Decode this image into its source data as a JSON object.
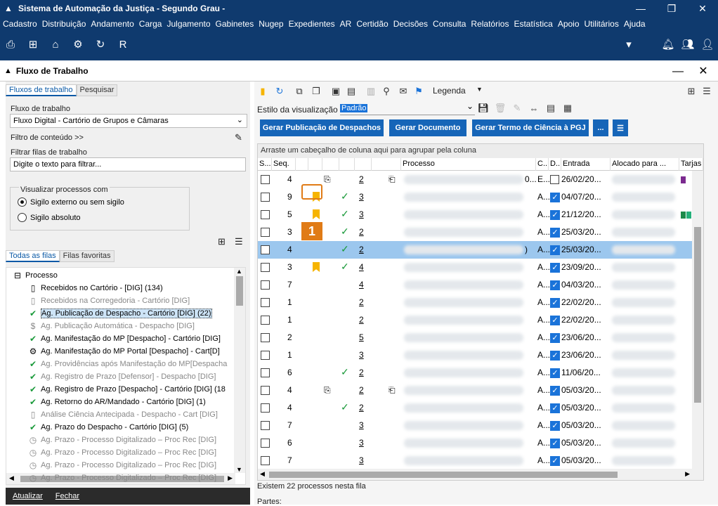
{
  "app": {
    "title": "Sistema de Automação da Justiça - Segundo Grau -",
    "window_buttons": [
      "restore",
      "maximize",
      "close"
    ]
  },
  "menu": [
    "Cadastro",
    "Distribuição",
    "Andamento",
    "Carga",
    "Julgamento",
    "Gabinetes",
    "Nugep",
    "Expedientes",
    "AR",
    "Certidão",
    "Decisões",
    "Consulta",
    "Relatórios",
    "Estatística",
    "Apoio",
    "Utilitários",
    "Ajuda"
  ],
  "toolbar_icons": [
    "print-icon",
    "org-chart-icon",
    "building-icon",
    "settings-icon",
    "refresh-doc-icon",
    "report-icon"
  ],
  "window": {
    "title": "Fluxo de Trabalho"
  },
  "left": {
    "tabs": [
      "Fluxos de trabalho",
      "Pesquisar"
    ],
    "fluxo_label": "Fluxo de trabalho",
    "fluxo_value": "Fluxo Digital - Cartório de Grupos e Câmaras",
    "filtro_conteudo": "Filtro de conteúdo >>",
    "filtrar_label": "Filtrar filas de trabalho",
    "filtrar_placeholder": "Digite o texto para filtrar...",
    "visualizar_label": "Visualizar processos com",
    "radio1": "Sigilo externo ou sem sigilo",
    "radio2": "Sigilo absoluto",
    "tree_tabs": [
      "Todas as filas",
      "Filas favoritas"
    ],
    "tree": [
      {
        "icon": "⊟",
        "text": "Processo",
        "grey": false,
        "indent": 0
      },
      {
        "icon": "▯",
        "text": "Recebidos no Cartório - [DIG] (134)",
        "grey": false,
        "indent": 1
      },
      {
        "icon": "▯",
        "text": "Recebidos na Corregedoria - Cartório [DIG]",
        "grey": true,
        "indent": 1
      },
      {
        "icon": "✔",
        "text": "Ag. Publicação de Despacho - Cartório [DIG] (22)",
        "grey": false,
        "indent": 1,
        "sel": true
      },
      {
        "icon": "$",
        "text": "Ag. Publicação Automática - Despacho [DIG]",
        "grey": true,
        "indent": 1
      },
      {
        "icon": "✔",
        "text": "Ag. Manifestação do MP [Despacho] - Cartório [DIG]",
        "grey": false,
        "indent": 1
      },
      {
        "icon": "⚙",
        "text": "Ag. Manifestação do MP Portal [Despacho] - Cart[D]",
        "grey": false,
        "indent": 1
      },
      {
        "icon": "✔",
        "text": "Ag. Providências após Manifestação do MP[Despacha",
        "grey": true,
        "indent": 1
      },
      {
        "icon": "✔",
        "text": "Ag. Registro de Prazo [Defensor] - Despacho [DIG]",
        "grey": true,
        "indent": 1
      },
      {
        "icon": "✔",
        "text": "Ag. Registro de Prazo [Despacho] - Cartório [DIG] (18",
        "grey": false,
        "indent": 1
      },
      {
        "icon": "✔",
        "text": "Ag. Retorno do AR/Mandado - Cartório [DIG] (1)",
        "grey": false,
        "indent": 1
      },
      {
        "icon": "▯",
        "text": "Análise Ciência Antecipada - Despacho - Cart [DIG]",
        "grey": true,
        "indent": 1
      },
      {
        "icon": "✔",
        "text": "Ag. Prazo do Despacho - Cartório [DIG] (5)",
        "grey": false,
        "indent": 1
      },
      {
        "icon": "◷",
        "text": "Ag. Prazo - Processo Digitalizado – Proc Rec [DIG]",
        "grey": true,
        "indent": 1
      },
      {
        "icon": "◷",
        "text": "Ag. Prazo - Processo Digitalizado – Proc Rec [DIG]",
        "grey": true,
        "indent": 1
      },
      {
        "icon": "◷",
        "text": "Ag. Prazo - Processo Digitalizado – Proc Rec [DIG]",
        "grey": true,
        "indent": 1
      },
      {
        "icon": "◷",
        "text": "Ag. Prazo - Processo Digitalizado – Proc Rec [DIG]",
        "grey": true,
        "indent": 1
      }
    ],
    "bottom": [
      "Atualizar",
      "Fechar"
    ]
  },
  "right": {
    "legenda": "Legenda",
    "estilo_label": "Estilo da visualização",
    "estilo_value": "Padrão",
    "buttons": [
      "Gerar Publicação de Despachos",
      "Gerar Documento",
      "Gerar Termo de Ciência à PGJ",
      "..."
    ],
    "group_hint": "Arraste um cabeçalho de coluna aqui para agrupar pela coluna",
    "columns": [
      "S...",
      "Seq.",
      "",
      "",
      "",
      "",
      "",
      "",
      "Processo",
      "C...",
      "D...",
      "Entrada",
      "Alocado para ...",
      "Tarjas"
    ],
    "rows": [
      {
        "seq": "4",
        "flag": false,
        "chk": false,
        "n": "2",
        "c": "E...",
        "c_prefix": "0...",
        "d": false,
        "entrada": "26/02/20...",
        "icons": [
          "doc-gear",
          "rotate"
        ],
        "tarja": [
          "#7b2a8f"
        ]
      },
      {
        "seq": "9",
        "flag": true,
        "chk": true,
        "n": "3",
        "c": "A...",
        "d": true,
        "entrada": "04/07/20...",
        "tarja": []
      },
      {
        "seq": "5",
        "flag": true,
        "chk": true,
        "n": "3",
        "c": "A...",
        "d": true,
        "entrada": "21/12/20...",
        "tarja": [
          "#1d8a4a",
          "#25b07a",
          "#2b6fd6"
        ]
      },
      {
        "seq": "3",
        "flag": false,
        "chk": true,
        "n": "2",
        "c": "A...",
        "d": true,
        "entrada": "25/03/20...",
        "tarja": []
      },
      {
        "seq": "4",
        "flag": false,
        "chk": true,
        "n": "2",
        "c": "A...",
        "c_prefix": ")",
        "d": true,
        "entrada": "25/03/20...",
        "sel": true,
        "tarja": []
      },
      {
        "seq": "3",
        "flag": true,
        "chk": true,
        "n": "4",
        "c": "A...",
        "d": true,
        "entrada": "23/09/20...",
        "tarja": []
      },
      {
        "seq": "7",
        "flag": false,
        "chk": false,
        "n": "4",
        "c": "A...",
        "d": true,
        "entrada": "04/03/20...",
        "tarja": []
      },
      {
        "seq": "1",
        "flag": false,
        "chk": false,
        "n": "2",
        "c": "A...",
        "d": true,
        "entrada": "22/02/20...",
        "tarja": []
      },
      {
        "seq": "1",
        "flag": false,
        "chk": false,
        "n": "2",
        "c": "A...",
        "d": true,
        "entrada": "22/02/20...",
        "tarja": []
      },
      {
        "seq": "2",
        "flag": false,
        "chk": false,
        "n": "5",
        "c": "A...",
        "d": true,
        "entrada": "23/06/20...",
        "tarja": []
      },
      {
        "seq": "1",
        "flag": false,
        "chk": false,
        "n": "3",
        "c": "A...",
        "d": true,
        "entrada": "23/06/20...",
        "tarja": []
      },
      {
        "seq": "6",
        "flag": false,
        "chk": true,
        "n": "2",
        "c": "A...",
        "d": true,
        "entrada": "11/06/20...",
        "tarja": []
      },
      {
        "seq": "4",
        "flag": false,
        "chk": false,
        "n": "2",
        "c": "A...",
        "d": true,
        "entrada": "05/03/20...",
        "icons": [
          "doc-gear",
          "rotate"
        ],
        "tarja": []
      },
      {
        "seq": "4",
        "flag": false,
        "chk": true,
        "n": "2",
        "c": "A...",
        "d": true,
        "entrada": "05/03/20...",
        "tarja": []
      },
      {
        "seq": "7",
        "flag": false,
        "chk": false,
        "n": "3",
        "c": "A...",
        "d": true,
        "entrada": "05/03/20...",
        "tarja": []
      },
      {
        "seq": "6",
        "flag": false,
        "chk": false,
        "n": "3",
        "c": "A...",
        "d": true,
        "entrada": "05/03/20...",
        "tarja": []
      },
      {
        "seq": "7",
        "flag": false,
        "chk": false,
        "n": "3",
        "c": "A...",
        "d": true,
        "entrada": "05/03/20...",
        "tarja": []
      }
    ],
    "status": "Existem 22 processos nesta fila",
    "partes": "Partes:"
  },
  "callout": {
    "number": "1",
    "color": "#e07b16"
  },
  "colors": {
    "titlebar": "#0f3a6e",
    "button": "#1665b8",
    "selection": "#9cc7ee",
    "flag": "#f6b400",
    "check": "#1a9a3a"
  }
}
